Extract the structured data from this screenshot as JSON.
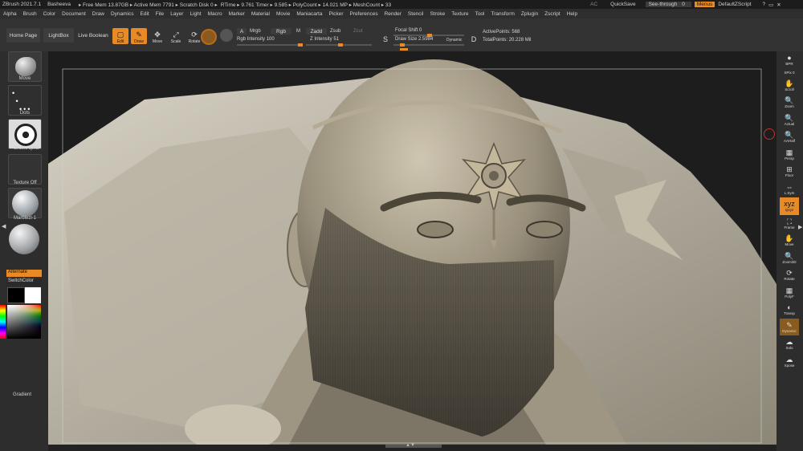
{
  "title_bar": {
    "app": "ZBrush 2021.7.1",
    "doc": "Basheeva",
    "stats": "▸ Free Mem 13.87GB ▸ Active Mem 7791 ▸ Scratch Disk 0 ▸",
    "timers": "RTime ▸ 9.761 Timer ▸ 9.585 ▸ PolyCount ▸ 14.021 MP ▸ MeshCount ▸ 33",
    "ac": "AC",
    "quicksave": "QuickSave",
    "seethrough": "See-through",
    "seethrough_value": "0",
    "menus": "Menus",
    "script": "DefaultZScript",
    "icons": [
      "question-icon",
      "window-icon",
      "close-icon"
    ]
  },
  "menu": [
    "Alpha",
    "Brush",
    "Color",
    "Document",
    "Draw",
    "Dynamics",
    "Edit",
    "File",
    "Layer",
    "Light",
    "Macro",
    "Marker",
    "Material",
    "Movie",
    "Maniacarta",
    "Picker",
    "Preferences",
    "Render",
    "Stencil",
    "Stroke",
    "Texture",
    "Tool",
    "Transform",
    "Zplugin",
    "Zscript",
    "Help"
  ],
  "shelf": {
    "home_page": "Home Page",
    "lightbox": "LightBox",
    "live_boolean": "Live Boolean",
    "tools": [
      {
        "label": "Edit",
        "icon": "edit-icon",
        "active": true
      },
      {
        "label": "Draw",
        "icon": "draw-icon",
        "active": true
      },
      {
        "label": "Move",
        "icon": "move-icon",
        "active": false
      },
      {
        "label": "Scale",
        "icon": "scale-icon",
        "active": false
      },
      {
        "label": "Rotate",
        "icon": "rotate-icon",
        "active": false
      }
    ],
    "a_btn": "A",
    "mrgb": "Mrgb",
    "rgb": "Rgb",
    "m": "M",
    "rgb_intensity_label": "Rgb Intensity",
    "rgb_intensity": "100",
    "zadd": "Zadd",
    "zsub": "Zsub",
    "zcut": "Zcut",
    "z_intensity_label": "Z Intensity",
    "z_intensity": "51",
    "focal_shift_label": "Focal Shift",
    "focal_shift": "0",
    "draw_size_label": "Draw Size",
    "draw_size": "2.5984",
    "dynamic": "Dynamic",
    "active_points_label": "ActivePoints:",
    "active_points": "568",
    "total_points_label": "TotalPoints:",
    "total_points": "20.228 Mil"
  },
  "left_panel": {
    "brush": "Move",
    "stroke": "Dots",
    "alpha": "~BrushAlpha",
    "texture": "Texture Off",
    "material": "Marblezl-1",
    "alternate": "Alternate",
    "switch_color": "SwitchColor",
    "gradient": "Gradient"
  },
  "right_panel": [
    {
      "label": "BPR",
      "icon": "sphere-icon"
    },
    {
      "label": "SPix 0",
      "icon": ""
    },
    {
      "label": "Scroll",
      "icon": "scroll-icon"
    },
    {
      "label": "Zoom",
      "icon": "zoom-icon"
    },
    {
      "label": "Actual",
      "icon": "actual-icon"
    },
    {
      "label": "AAHalf",
      "icon": "aahalf-icon"
    },
    {
      "label": "Persp",
      "icon": "persp-icon"
    },
    {
      "label": "Floor",
      "icon": "floor-icon"
    },
    {
      "label": "L.Sym",
      "icon": "lsym-icon"
    },
    {
      "label": "Qxyz",
      "icon": "xyz-icon"
    },
    {
      "label": "Frame",
      "icon": "frame-icon"
    },
    {
      "label": "Move",
      "icon": "move-icon"
    },
    {
      "label": "Zoom3D",
      "icon": "zoom3d-icon"
    },
    {
      "label": "Rotate",
      "icon": "rotate-icon"
    },
    {
      "label": "PolyF",
      "icon": "polyf-icon"
    },
    {
      "label": "Transp",
      "icon": "transp-icon"
    },
    {
      "label": "Dynamic",
      "icon": "dynamic-icon"
    },
    {
      "label": "Solo",
      "icon": "solo-icon"
    },
    {
      "label": "Xpose",
      "icon": "xpose-icon"
    }
  ],
  "colors": {
    "accent": "#e98a25",
    "panel": "#2d2d2d",
    "viewport_bg": "#1f1f1f",
    "clay": "#9c9482"
  }
}
